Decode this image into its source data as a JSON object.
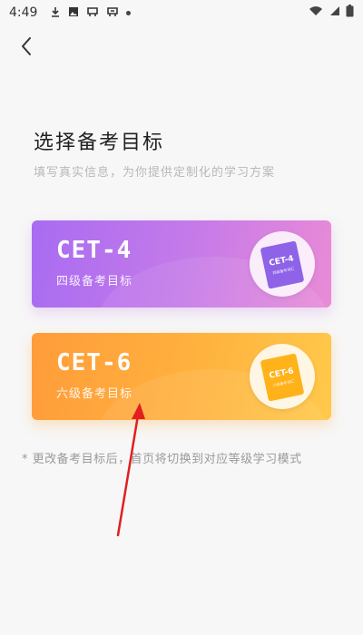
{
  "status_bar": {
    "time": "4:49",
    "icons_left": [
      "download-icon",
      "photo-icon",
      "app-icon-1",
      "app-icon-2",
      "dot"
    ],
    "icons_right": [
      "wifi-icon",
      "signal-icon",
      "battery-icon"
    ]
  },
  "header": {
    "title": "选择备考目标",
    "subtitle": "填写真实信息，为你提供定制化的学习方案"
  },
  "cards": [
    {
      "title": "CET-4",
      "subtitle": "四级备考目标",
      "book_label": "CET-4",
      "book_sub": "四级备考词汇",
      "color": "#a86cf2"
    },
    {
      "title": "CET-6",
      "subtitle": "六级备考目标",
      "book_label": "CET-6",
      "book_sub": "六级备考词汇",
      "color": "#ff9c3a"
    }
  ],
  "footer_note": "* 更改备考目标后，首页将切换到对应等级学习模式",
  "colors": {
    "annotation_arrow": "#e02020",
    "background": "#f7f7f7"
  }
}
